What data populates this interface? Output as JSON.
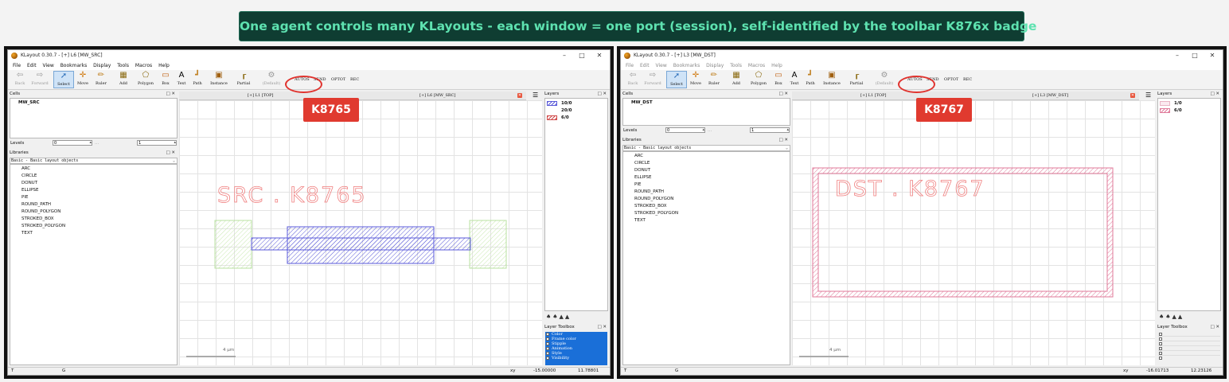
{
  "banner": "One agent controls many KLayouts - each window = one port (session), self-identified by the toolbar K876x badge",
  "colors": {
    "accent_red": "#e03a2f",
    "banner_bg": "#0f3d32",
    "banner_text": "#5ee2b0",
    "blue_layer": "#5a5ad8",
    "green_layer": "#b8e0a0",
    "pink_layer": "#e07a9a"
  },
  "tool_icons": [
    "arrow-left-icon",
    "arrow-right-icon",
    "cursor-icon",
    "move-cross-icon",
    "ruler-icon",
    "add-icon",
    "polygon-icon",
    "box-icon",
    "text-icon",
    "path-icon",
    "instance-icon",
    "partial-icon",
    "default-icon"
  ],
  "windows": [
    {
      "title": "KLayout 0.30.7 - [+] L6 [MW_SRC]",
      "controls": [
        "–",
        "□",
        "✕"
      ],
      "menu": [
        "File",
        "Edit",
        "View",
        "Bookmarks",
        "Display",
        "Tools",
        "Macros",
        "Help"
      ],
      "tools": [
        "Back",
        "Forward",
        "Select",
        "Move",
        "Ruler",
        "Add",
        "Polygon",
        "Box",
        "Text",
        "Path",
        "Instance",
        "Partial",
        "(Default)"
      ],
      "extra_tools": [
        "AUTOS",
        "SEND",
        "OPTOT",
        "REC"
      ],
      "badge": "K8765",
      "cells_header": "Cells",
      "cell_name": "MW_SRC",
      "levels_label": "Levels",
      "levels_from": "0",
      "levels_to": "1",
      "levels_dots": "...",
      "libraries_header": "Libraries",
      "library_select": "Basic - Basic layout objects",
      "library_items": [
        "ARC",
        "CIRCLE",
        "DONUT",
        "ELLIPSE",
        "PIE",
        "ROUND_PATH",
        "ROUND_POLYGON",
        "STROKED_BOX",
        "STROKED_POLYGON",
        "TEXT"
      ],
      "tabs": [
        "[+] L1 [TOP]",
        "[+] L6 [MW_SRC]"
      ],
      "canvas_text": "SRC . K8765",
      "scale_label": "4 µm",
      "layers_header": "Layers",
      "layers": [
        {
          "name": "10/0",
          "swatch": "blue"
        },
        {
          "name": "20/0",
          "swatch": "none"
        },
        {
          "name": "6/0",
          "swatch": "red"
        }
      ],
      "layer_toolbox_header": "Layer Toolbox",
      "toolbox_items": [
        "Color",
        "Frame color",
        "Stipple",
        "Animation",
        "Style",
        "Visibility"
      ],
      "status": {
        "t": "T",
        "g": "G",
        "xy": "xy",
        "x": "-15.00000",
        "y": "11.78801"
      }
    },
    {
      "title": "KLayout 0.30.7 - [+] L3 [MW_DST]",
      "controls": [
        "–",
        "□",
        "✕"
      ],
      "menu": [
        "File",
        "Edit",
        "View",
        "Bookmarks",
        "Display",
        "Tools",
        "Macros",
        "Help"
      ],
      "tools": [
        "Back",
        "Forward",
        "Select",
        "Move",
        "Ruler",
        "Add",
        "Polygon",
        "Box",
        "Text",
        "Path",
        "Instance",
        "Partial",
        "(Default)"
      ],
      "extra_tools": [
        "AUTOS",
        "SEND",
        "OPTOT",
        "REC"
      ],
      "badge": "K8767",
      "cells_header": "Cells",
      "cell_name": "MW_DST",
      "levels_label": "Levels",
      "levels_from": "0",
      "levels_to": "1",
      "levels_dots": "...",
      "libraries_header": "Libraries",
      "library_select": "Basic - Basic layout objects",
      "library_items": [
        "ARC",
        "CIRCLE",
        "DONUT",
        "ELLIPSE",
        "PIE",
        "ROUND_PATH",
        "ROUND_POLYGON",
        "STROKED_BOX",
        "STROKED_POLYGON",
        "TEXT"
      ],
      "tabs": [
        "[+] L1 [TOP]",
        "[+] L3 [MW_DST]"
      ],
      "canvas_text": "DST . K8767",
      "scale_label": "4 µm",
      "layers_header": "Layers",
      "layers": [
        {
          "name": "1/0",
          "swatch": "pale"
        },
        {
          "name": "6/0",
          "swatch": "pink"
        }
      ],
      "layer_toolbox_header": "Layer Toolbox",
      "toolbox_items": [],
      "status": {
        "t": "T",
        "g": "G",
        "xy": "xy",
        "x": "-16.01713",
        "y": "12.23126"
      }
    }
  ]
}
